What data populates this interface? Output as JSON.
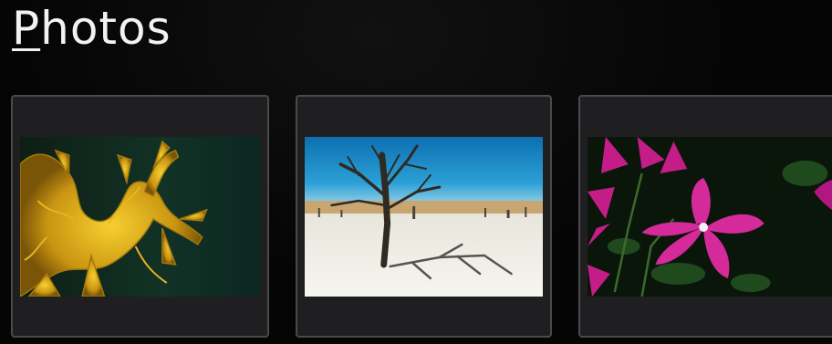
{
  "header": {
    "title_first_letter": "P",
    "title_rest": "hotos"
  },
  "gallery": {
    "items": [
      {
        "icon": "sea-dragon-photo-icon"
      },
      {
        "icon": "desert-tree-photo-icon"
      },
      {
        "icon": "pink-flowers-photo-icon"
      }
    ]
  },
  "colors": {
    "background": "#050505",
    "tile_background": "#1f1f21",
    "tile_border": "#4a4a4c",
    "title_text": "#f2f2f2"
  }
}
